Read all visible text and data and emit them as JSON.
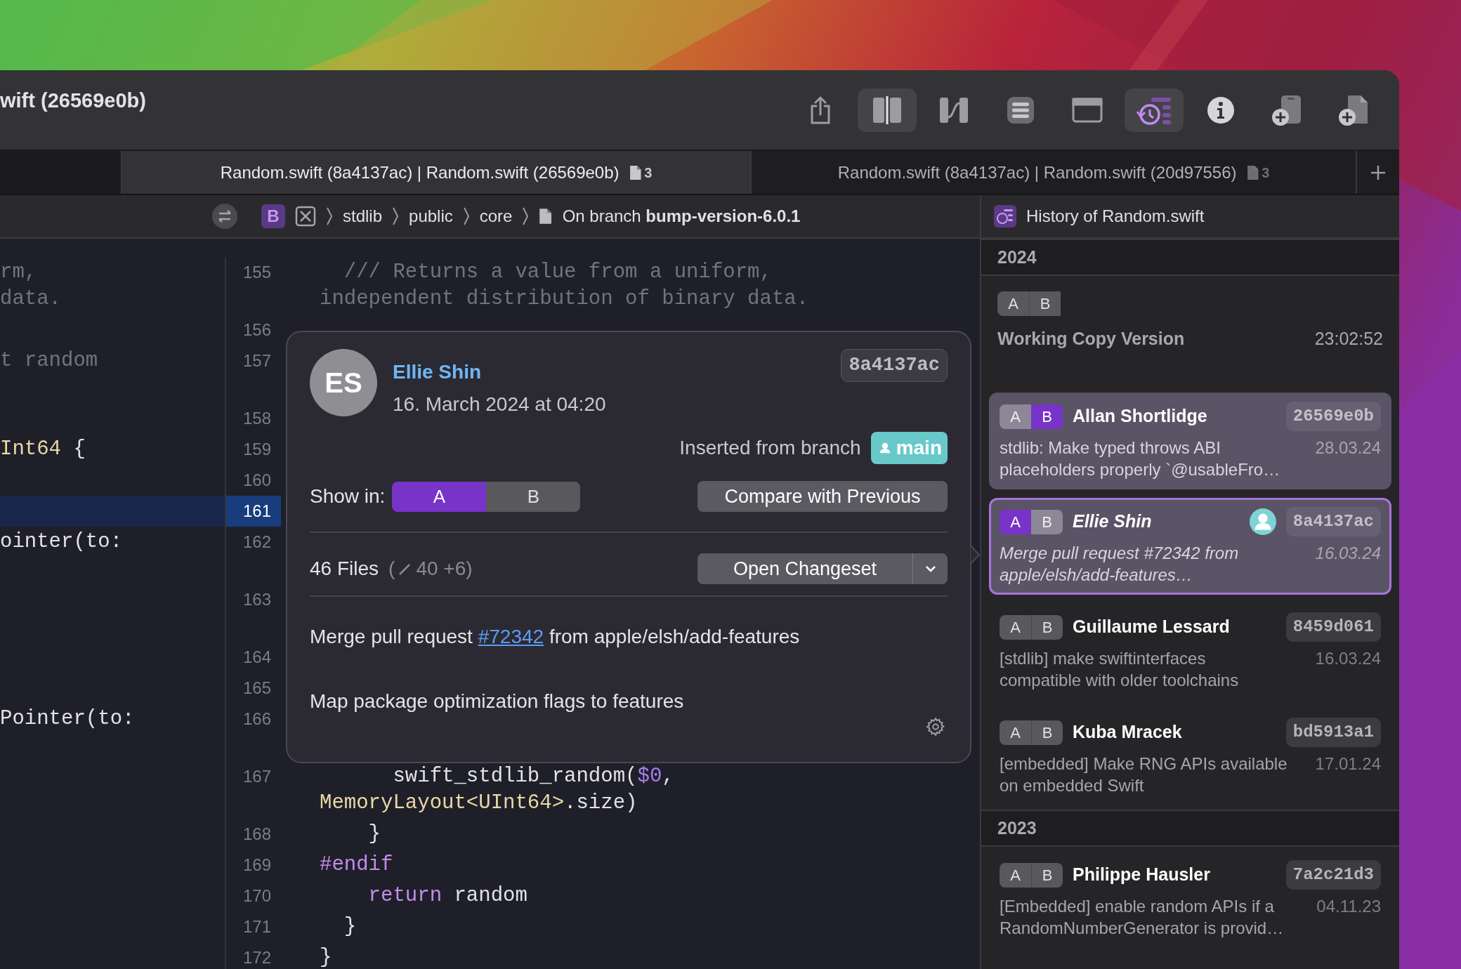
{
  "window": {
    "title": "wift (26569e0b)"
  },
  "toolbar": {
    "items": [
      {
        "kind": "share",
        "selected": false
      },
      {
        "kind": "split",
        "selected": true
      },
      {
        "kind": "diff",
        "selected": false
      },
      {
        "kind": "list",
        "selected": false
      },
      {
        "kind": "window",
        "selected": false
      },
      {
        "kind": "history",
        "selected": true
      },
      {
        "kind": "info",
        "selected": false
      },
      {
        "kind": "add_device",
        "selected": false
      },
      {
        "kind": "add_file",
        "selected": false
      }
    ]
  },
  "tabs": [
    {
      "label": "Random.swift (8a4137ac) | Random.swift (26569e0b)",
      "count": "3",
      "selected": true
    },
    {
      "label": "Random.swift (8a4137ac) | Random.swift (20d97556)",
      "count": "3",
      "selected": false
    }
  ],
  "breadcrumb": {
    "badge": "B",
    "items": [
      "stdlib",
      "public",
      "core"
    ],
    "branch": "On branch **bump-version-6.0.1**"
  },
  "history_header": "History of Random.swift",
  "editor": {
    "rows": [
      {
        "number": "155",
        "wrapped": true,
        "selected": false,
        "left": [
          [
            {
              "kind": "comment",
              "text": "rm,"
            }
          ],
          [
            {
              "kind": "comment",
              "text": "data."
            }
          ]
        ],
        "right": [
          [
            {
              "kind": "comment",
              "text": "  /// Returns a value from a uniform,"
            }
          ],
          [
            {
              "kind": "comment",
              "text": "independent distribution of binary data."
            }
          ]
        ]
      },
      {
        "number": "156",
        "wrapped": false,
        "selected": false
      },
      {
        "number": "157",
        "wrapped": true,
        "selected": false,
        "left": [
          [
            {
              "kind": "comment",
              "text": "t random"
            }
          ]
        ]
      },
      {
        "number": "158",
        "wrapped": false,
        "selected": false
      },
      {
        "number": "159",
        "wrapped": false,
        "selected": false,
        "left": [
          [
            {
              "kind": "type",
              "text": "Int64"
            },
            {
              "kind": "plain",
              "text": " {"
            }
          ]
        ]
      },
      {
        "number": "160",
        "wrapped": false,
        "selected": false
      },
      {
        "number": "161",
        "wrapped": false,
        "selected": true
      },
      {
        "number": "162",
        "wrapped": true,
        "selected": false,
        "left": [
          [
            {
              "kind": "plain",
              "text": "ointer(to:"
            }
          ]
        ]
      },
      {
        "number": "163",
        "wrapped": true,
        "selected": false
      },
      {
        "number": "164",
        "wrapped": false,
        "selected": false
      },
      {
        "number": "165",
        "wrapped": false,
        "selected": false
      },
      {
        "number": "166",
        "wrapped": true,
        "selected": false,
        "left": [
          [
            {
              "kind": "plain",
              "text": "Pointer(to:"
            }
          ]
        ]
      },
      {
        "number": "167",
        "wrapped": true,
        "selected": false,
        "right": [
          [
            {
              "kind": "plain",
              "text": "      swift_stdlib_random("
            },
            {
              "kind": "number",
              "text": "$0"
            },
            {
              "kind": "plain",
              "text": ","
            }
          ],
          [
            {
              "kind": "type",
              "text": "MemoryLayout<UInt64>"
            },
            {
              "kind": "plain",
              "text": ".size)"
            }
          ]
        ]
      },
      {
        "number": "168",
        "wrapped": false,
        "selected": false,
        "right": [
          [
            {
              "kind": "plain",
              "text": "    }"
            }
          ]
        ]
      },
      {
        "number": "169",
        "wrapped": false,
        "selected": false,
        "right": [
          [
            {
              "kind": "keyword",
              "text": "#endif"
            }
          ]
        ]
      },
      {
        "number": "170",
        "wrapped": false,
        "selected": false,
        "right": [
          [
            {
              "kind": "keyword",
              "text": "    return"
            },
            {
              "kind": "plain",
              "text": " random"
            }
          ]
        ]
      },
      {
        "number": "171",
        "wrapped": false,
        "selected": false,
        "right": [
          [
            {
              "kind": "plain",
              "text": "  }"
            }
          ]
        ]
      },
      {
        "number": "172",
        "wrapped": false,
        "selected": false,
        "right": [
          [
            {
              "kind": "plain",
              "text": "}"
            }
          ]
        ]
      }
    ]
  },
  "popover": {
    "initials": "ES",
    "author": "Ellie Shin",
    "date": "16. March 2024 at 04:20",
    "hash": "8a4137ac",
    "inserted_label": "Inserted from branch",
    "branch": "main",
    "show_in_label": "Show in:",
    "show": [
      {
        "label": "A",
        "selected": true
      },
      {
        "label": "B",
        "selected": false
      }
    ],
    "compare_button": "Compare with Previous",
    "files": "46 Files",
    "stats_prefix": "(",
    "stats": "40 +6)",
    "changeset_button": "Open Changeset",
    "message_before": "Merge pull request ",
    "message_link": "#72342",
    "message_after": " from apple/elsh/add-features",
    "body": "Map package optimization flags to features"
  },
  "history": {
    "sections": [
      {
        "year": "2024",
        "entries": [
          {
            "kind": "working_copy",
            "show": [
              {
                "label": "A",
                "selected": false
              },
              {
                "label": "B",
                "selected": false
              }
            ],
            "title": "Working Copy Version",
            "time": "23:02:52"
          },
          {
            "kind": "commit",
            "show": [
              {
                "label": "A",
                "selected": false
              },
              {
                "label": "B",
                "selected": true
              }
            ],
            "author": "Allan Shortlidge",
            "hash": "26569e0b",
            "message": "stdlib: Make typed throws ABI placeholders properly `@usableFro…",
            "date": "28.03.24",
            "selected": false,
            "branch_user": false
          },
          {
            "kind": "commit",
            "show": [
              {
                "label": "A",
                "selected": true
              },
              {
                "label": "B",
                "selected": false
              }
            ],
            "author": "Ellie Shin",
            "hash": "8a4137ac",
            "message": "Merge pull request #72342 from apple/elsh/add-features…",
            "date": "16.03.24",
            "selected": true,
            "branch_user": true
          },
          {
            "kind": "commit",
            "show": [
              {
                "label": "A",
                "selected": false
              },
              {
                "label": "B",
                "selected": false
              }
            ],
            "author": "Guillaume Lessard",
            "hash": "8459d061",
            "message": "[stdlib] make swiftinterfaces compatible with older toolchains",
            "date": "16.03.24",
            "selected": false,
            "branch_user": false
          },
          {
            "kind": "commit",
            "show": [
              {
                "label": "A",
                "selected": false
              },
              {
                "label": "B",
                "selected": false
              }
            ],
            "author": "Kuba Mracek",
            "hash": "bd5913a1",
            "message": "[embedded] Make RNG APIs available on embedded Swift",
            "date": "17.01.24",
            "selected": false,
            "branch_user": false
          }
        ]
      },
      {
        "year": "2023",
        "entries": [
          {
            "kind": "commit",
            "show": [
              {
                "label": "A",
                "selected": false
              },
              {
                "label": "B",
                "selected": false
              }
            ],
            "author": "Philippe Hausler",
            "hash": "7a2c21d3",
            "message": "[Embedded] enable random APIs if a RandomNumberGenerator is provid…",
            "date": "04.11.23",
            "selected": false,
            "branch_user": false
          }
        ]
      }
    ]
  }
}
